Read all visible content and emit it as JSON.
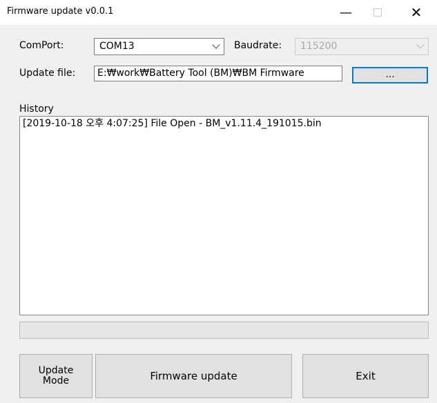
{
  "window": {
    "title": "Firmware update v0.0.1",
    "controls": {
      "minimize": "—",
      "close": "✕"
    }
  },
  "serial": {
    "comport_label": "ComPort:",
    "comport_value": "COM13",
    "baudrate_label": "Baudrate:",
    "baudrate_value": "115200"
  },
  "file": {
    "label": "Update file:",
    "path": "E:₩work₩Battery Tool (BM)₩BM Firmware",
    "browse_label": "..."
  },
  "history": {
    "label": "History",
    "entries": [
      "[2019-10-18 오후 4:07:25]   File Open - BM_v1.11.4_191015.bin"
    ]
  },
  "progress": {
    "value": 0
  },
  "buttons": {
    "update_mode_line1": "Update",
    "update_mode_line2": "Mode",
    "firmware_update": "Firmware update",
    "exit": "Exit"
  }
}
